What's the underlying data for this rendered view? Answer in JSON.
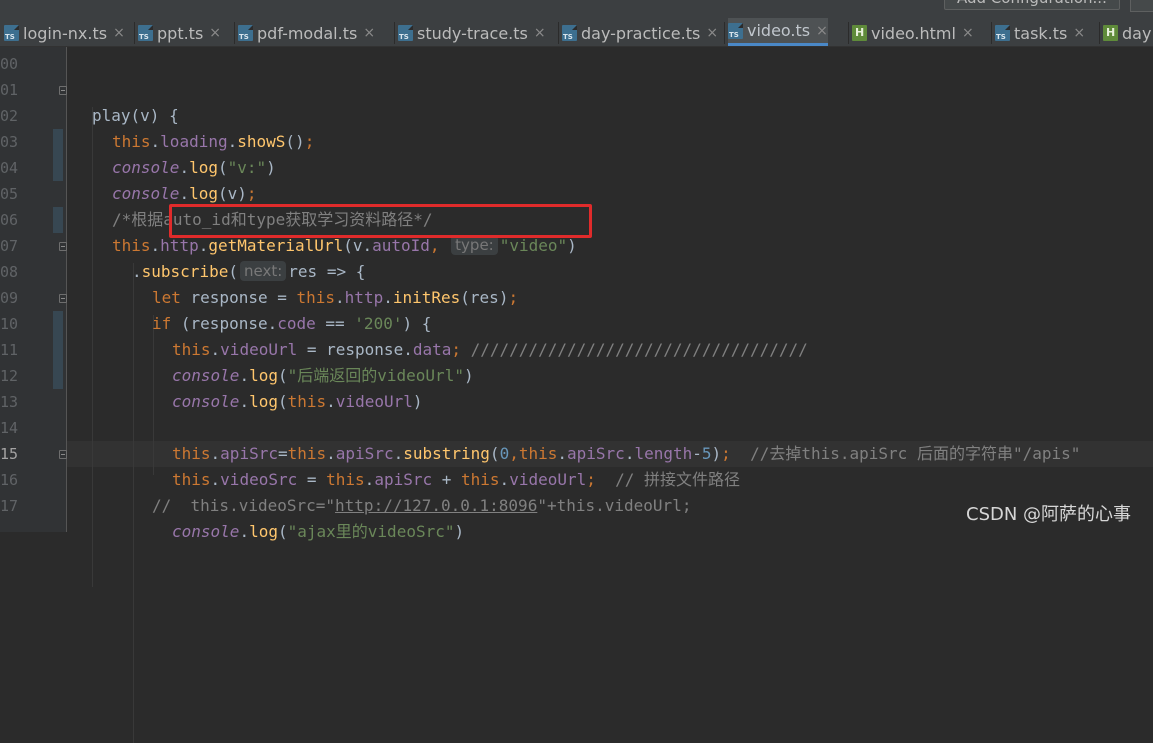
{
  "toolbar": {
    "config_label": "Add Configuration..."
  },
  "tabs": [
    {
      "label": "login-nx.ts",
      "icon": "typescript-file-icon",
      "active": false
    },
    {
      "label": "ppt.ts",
      "icon": "typescript-file-icon",
      "active": false
    },
    {
      "label": "pdf-modal.ts",
      "icon": "typescript-file-icon",
      "active": false
    },
    {
      "label": "study-trace.ts",
      "icon": "typescript-file-icon",
      "active": false
    },
    {
      "label": "day-practice.ts",
      "icon": "typescript-file-icon",
      "active": false
    },
    {
      "label": "video.ts",
      "icon": "typescript-file-icon",
      "active": true
    },
    {
      "label": "video.html",
      "icon": "html-file-icon",
      "active": false
    },
    {
      "label": "task.ts",
      "icon": "typescript-file-icon",
      "active": false
    },
    {
      "label": "day",
      "icon": "html-file-icon",
      "active": false
    }
  ],
  "tab_close_glyph": "×",
  "gutter": {
    "line_numbers": [
      "00",
      "01",
      "02",
      "03",
      "04",
      "05",
      "06",
      "07",
      "08",
      "09",
      "10",
      "11",
      "12",
      "13",
      "14",
      "15",
      "16",
      "17"
    ],
    "current_line": "15"
  },
  "code_lines": [
    [],
    [
      [
        "",
        "play"
      ],
      [
        "",
        "(v) {"
      ]
    ],
    [
      [
        "kw",
        "this"
      ],
      [
        "",
        "."
      ],
      [
        "prop",
        "loading"
      ],
      [
        "",
        "."
      ],
      [
        "fn",
        "showS"
      ],
      [
        "",
        "()"
      ],
      [
        "kw",
        ";"
      ]
    ],
    [
      [
        "con",
        "console"
      ],
      [
        "",
        "."
      ],
      [
        "fn",
        "log"
      ],
      [
        "",
        "("
      ],
      [
        "str",
        "\"v:\""
      ],
      [
        "",
        ")"
      ]
    ],
    [
      [
        "con",
        "console"
      ],
      [
        "",
        "."
      ],
      [
        "fn",
        "log"
      ],
      [
        "",
        "(v)"
      ],
      [
        "kw",
        ";"
      ]
    ],
    [
      [
        "com",
        "/*根据auto_id和type获取学习资料路径*/"
      ]
    ],
    [
      [
        "kw",
        "this"
      ],
      [
        "",
        "."
      ],
      [
        "prop",
        "http"
      ],
      [
        "",
        "."
      ],
      [
        "fn",
        "getMaterialUrl"
      ],
      [
        "",
        "(v."
      ],
      [
        "prop",
        "autoId"
      ],
      [
        "kw",
        ", "
      ],
      [
        "hint",
        "type:"
      ],
      [
        "str",
        "\"video\""
      ],
      [
        "",
        ")"
      ]
    ],
    [
      [
        "",
        "."
      ],
      [
        "fn",
        "subscribe"
      ],
      [
        "",
        "("
      ],
      [
        "hint",
        "next:"
      ],
      [
        "",
        "res => {"
      ]
    ],
    [
      [
        "kw",
        "let "
      ],
      [
        "",
        "response = "
      ],
      [
        "kw",
        "this"
      ],
      [
        "",
        "."
      ],
      [
        "prop",
        "http"
      ],
      [
        "",
        "."
      ],
      [
        "fn",
        "initRes"
      ],
      [
        "",
        "(res)"
      ],
      [
        "kw",
        ";"
      ]
    ],
    [
      [
        "kw",
        "if "
      ],
      [
        "",
        "(response."
      ],
      [
        "prop",
        "code"
      ],
      [
        "",
        " == "
      ],
      [
        "str",
        "'200'"
      ],
      [
        "",
        ") {"
      ]
    ],
    [
      [
        "kw",
        "this"
      ],
      [
        "",
        "."
      ],
      [
        "prop",
        "videoUrl"
      ],
      [
        "",
        " = response."
      ],
      [
        "prop",
        "data"
      ],
      [
        "kw",
        ";"
      ],
      [
        "com",
        " ///////////////////////////////////"
      ]
    ],
    [
      [
        "con",
        "console"
      ],
      [
        "",
        "."
      ],
      [
        "fn",
        "log"
      ],
      [
        "",
        "("
      ],
      [
        "str",
        "\"后端返回的videoUrl\""
      ],
      [
        "",
        ")"
      ]
    ],
    [
      [
        "con",
        "console"
      ],
      [
        "",
        "."
      ],
      [
        "fn",
        "log"
      ],
      [
        "",
        "("
      ],
      [
        "kw",
        "this"
      ],
      [
        "",
        "."
      ],
      [
        "prop",
        "videoUrl"
      ],
      [
        "",
        ")"
      ]
    ],
    [],
    [
      [
        "kw",
        "this"
      ],
      [
        "",
        "."
      ],
      [
        "prop",
        "apiSrc"
      ],
      [
        "",
        "="
      ],
      [
        "kw",
        "this"
      ],
      [
        "",
        "."
      ],
      [
        "prop",
        "apiSrc"
      ],
      [
        "",
        "."
      ],
      [
        "fn",
        "substring"
      ],
      [
        "",
        "("
      ],
      [
        "num",
        "0"
      ],
      [
        "kw",
        ","
      ],
      [
        "kw",
        "this"
      ],
      [
        "",
        "."
      ],
      [
        "prop",
        "apiSrc"
      ],
      [
        "",
        "."
      ],
      [
        "prop",
        "length"
      ],
      [
        "",
        "-"
      ],
      [
        "num",
        "5"
      ],
      [
        "",
        ")"
      ],
      [
        "kw",
        ";"
      ],
      [
        "com",
        "  //去掉this.apiSrc 后面的字符串\"/apis\""
      ]
    ],
    [
      [
        "kw",
        "this"
      ],
      [
        "",
        "."
      ],
      [
        "prop",
        "videoSrc"
      ],
      [
        "",
        " = "
      ],
      [
        "kw",
        "this"
      ],
      [
        "",
        "."
      ],
      [
        "prop",
        "apiSrc"
      ],
      [
        "",
        " + "
      ],
      [
        "kw",
        "this"
      ],
      [
        "",
        "."
      ],
      [
        "prop",
        "videoUrl"
      ],
      [
        "kw",
        ";"
      ],
      [
        "com",
        "  // 拼接文件路径"
      ]
    ],
    [
      [
        "com",
        "//  this.videoSrc=\""
      ],
      [
        "lnk",
        "http://127.0.0.1:8096"
      ],
      [
        "com",
        "\"+this.videoUrl;"
      ]
    ],
    [
      [
        "con",
        "console"
      ],
      [
        "",
        "."
      ],
      [
        "fn",
        "log"
      ],
      [
        "",
        "("
      ],
      [
        "str",
        "\"ajax里的videoSrc\""
      ],
      [
        "",
        ")"
      ]
    ]
  ],
  "watermark": "CSDN @阿萨的心事"
}
